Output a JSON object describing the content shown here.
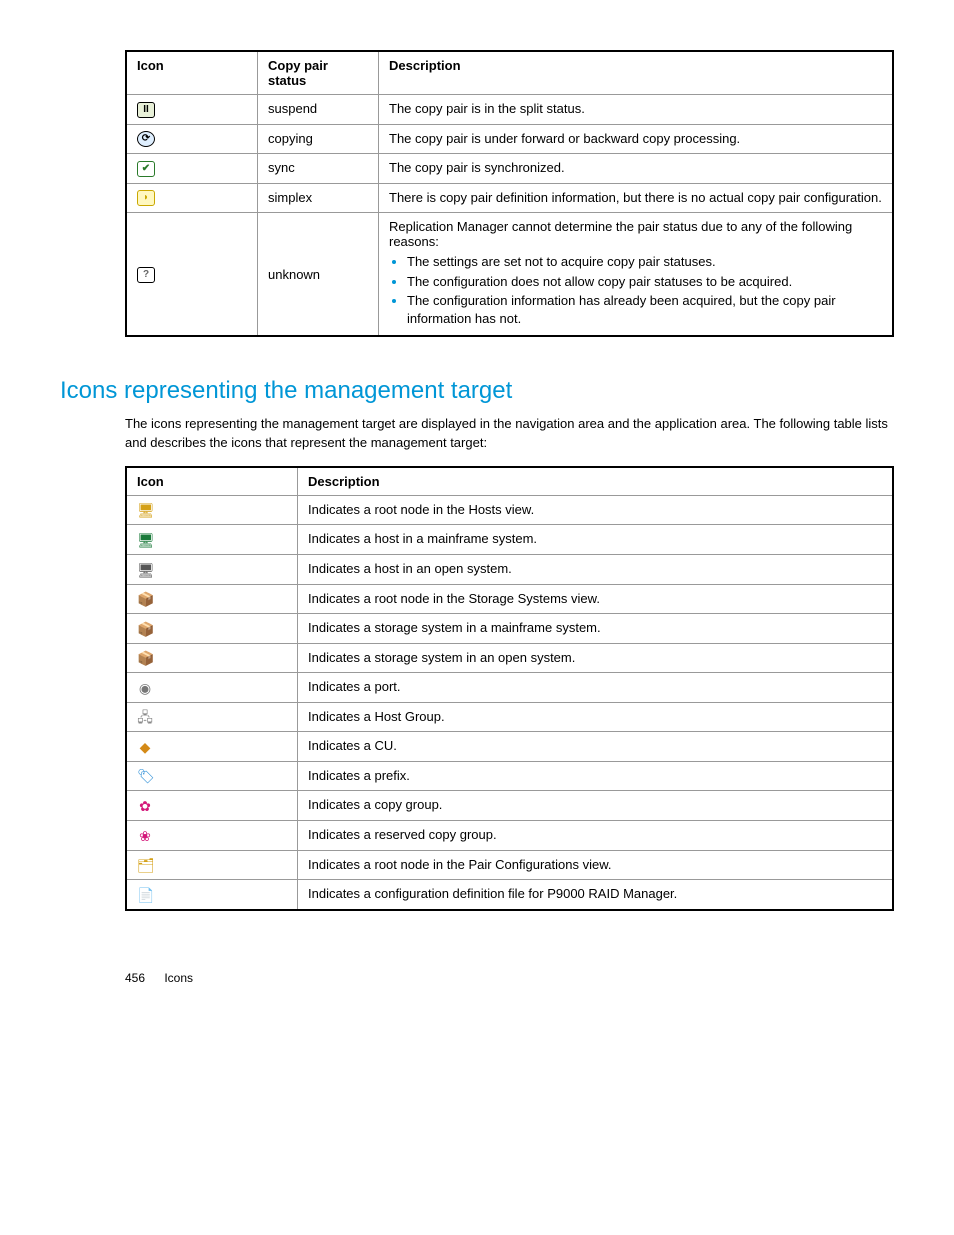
{
  "table1": {
    "headers": {
      "icon": "Icon",
      "status": "Copy pair status",
      "desc": "Description"
    },
    "rows": [
      {
        "status": "suspend",
        "desc": "The copy pair is in the split status."
      },
      {
        "status": "copying",
        "desc": "The copy pair is under forward or backward copy processing."
      },
      {
        "status": "sync",
        "desc": "The copy pair is synchronized."
      },
      {
        "status": "simplex",
        "desc": "There is copy pair definition information, but there is no actual copy pair configuration."
      },
      {
        "status": "unknown",
        "desc_intro": "Replication Manager cannot determine the pair status due to any of the following reasons:",
        "bullets": [
          "The settings are set not to acquire copy pair statuses.",
          "The configuration does not allow copy pair statuses to be acquired.",
          "The configuration information has already been acquired, but the copy pair information has not."
        ]
      }
    ]
  },
  "heading": "Icons representing the management target",
  "intro": "The icons representing the management target are displayed in the navigation area and the application area. The following table lists and describes the icons that represent the management target:",
  "table2": {
    "headers": {
      "icon": "Icon",
      "desc": "Description"
    },
    "rows": [
      {
        "desc": "Indicates a root node in the Hosts view."
      },
      {
        "desc": "Indicates a host in a mainframe system."
      },
      {
        "desc": "Indicates a host in an open system."
      },
      {
        "desc": "Indicates a root node in the Storage Systems view."
      },
      {
        "desc": "Indicates a storage system in a mainframe system."
      },
      {
        "desc": "Indicates a storage system in an open system."
      },
      {
        "desc": "Indicates a port."
      },
      {
        "desc": "Indicates a Host Group."
      },
      {
        "desc": "Indicates a CU."
      },
      {
        "desc": "Indicates a prefix."
      },
      {
        "desc": "Indicates a copy group."
      },
      {
        "desc": "Indicates a reserved copy group."
      },
      {
        "desc": "Indicates a root node in the Pair Configurations view."
      },
      {
        "desc": "Indicates a configuration definition file for P9000 RAID Manager."
      }
    ]
  },
  "footer": {
    "page": "456",
    "section": "Icons"
  }
}
